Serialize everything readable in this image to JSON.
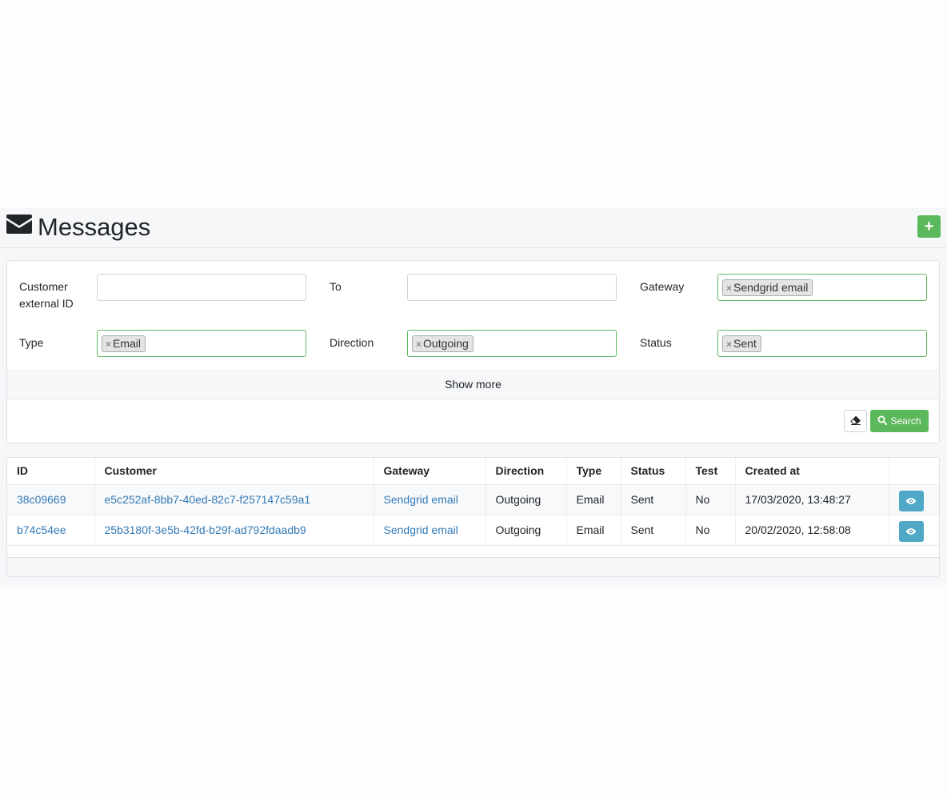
{
  "header": {
    "title": "Messages",
    "title_icon": "envelope-icon",
    "add_label": "+"
  },
  "filters": {
    "customer_external_id": {
      "label": "Customer external ID",
      "value": ""
    },
    "to": {
      "label": "To",
      "value": ""
    },
    "gateway": {
      "label": "Gateway",
      "tag": "Sendgrid email"
    },
    "type": {
      "label": "Type",
      "tag": "Email"
    },
    "direction": {
      "label": "Direction",
      "tag": "Outgoing"
    },
    "status": {
      "label": "Status",
      "tag": "Sent"
    },
    "tag_remove": "×",
    "show_more": "Show more",
    "search_label": "Search"
  },
  "table": {
    "columns": [
      "ID",
      "Customer",
      "Gateway",
      "Direction",
      "Type",
      "Status",
      "Test",
      "Created at"
    ],
    "rows": [
      [
        "38c09669",
        "e5c252af-8bb7-40ed-82c7-f257147c59a1",
        "Sendgrid email",
        "Outgoing",
        "Email",
        "Sent",
        "No",
        "17/03/2020, 13:48:27"
      ],
      [
        "b74c54ee",
        "25b3180f-3e5b-42fd-b29f-ad792fdaadb9",
        "Sendgrid email",
        "Outgoing",
        "Email",
        "Sent",
        "No",
        "20/02/2020, 12:58:08"
      ]
    ]
  },
  "colors": {
    "primary_green": "#5cb85c",
    "link_blue": "#337ab7",
    "info_blue": "#5bc0de"
  }
}
